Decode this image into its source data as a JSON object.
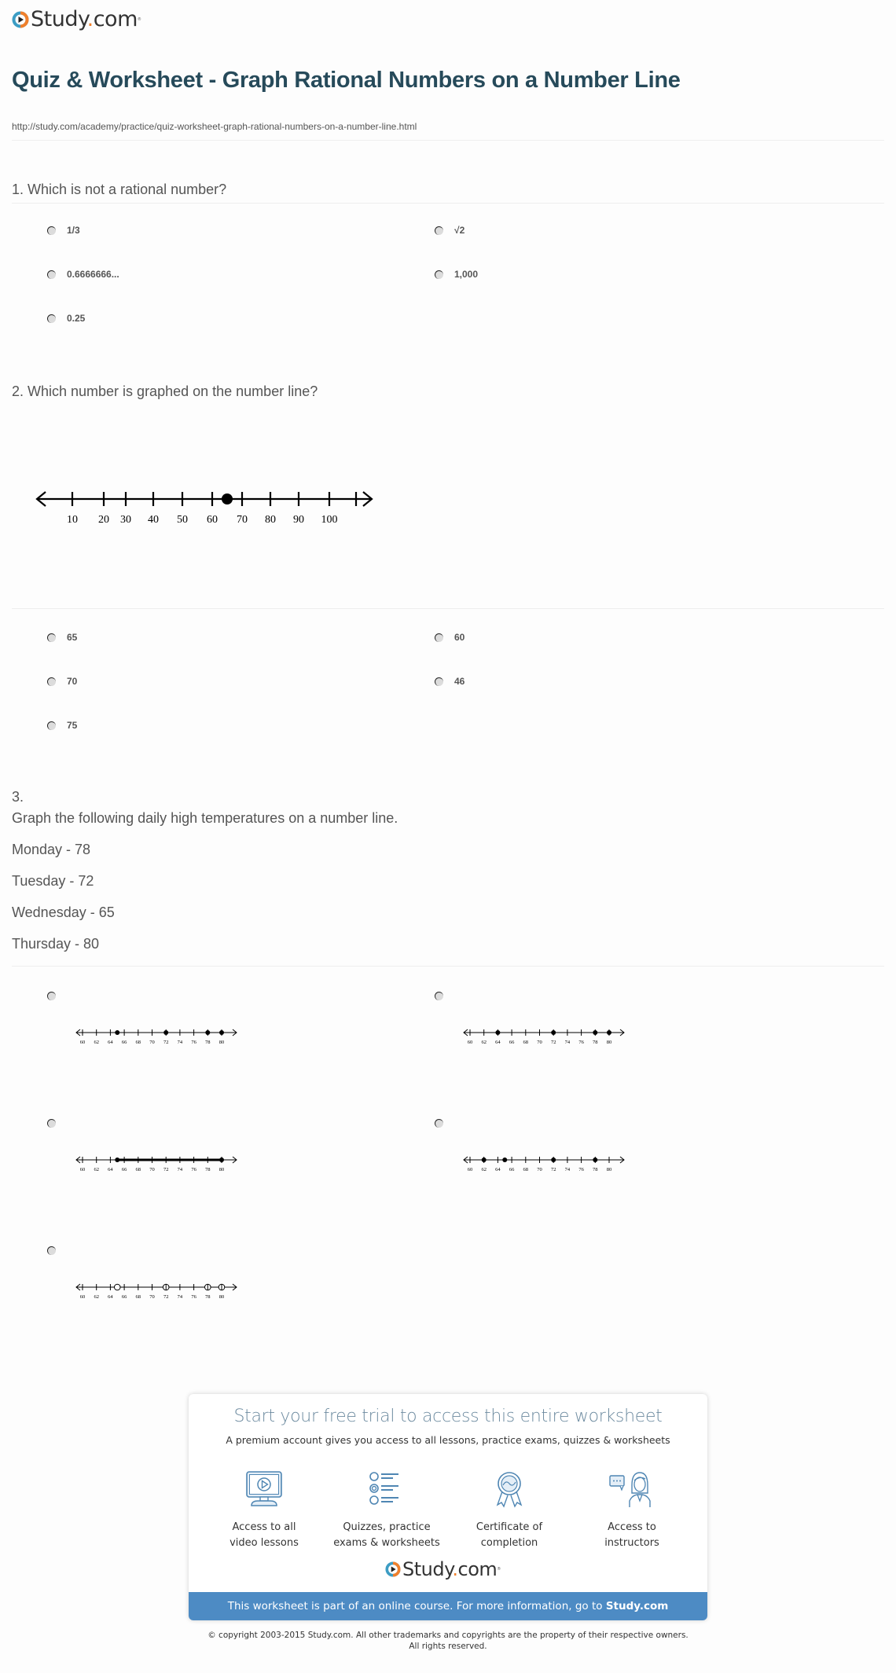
{
  "brand": {
    "name": "Study",
    "dot": ".",
    "tld": "com",
    "reg": "®",
    "colors": {
      "ring_blue": "#3d9dc4",
      "ring_orange": "#f0802c",
      "text": "#333333",
      "title": "#264a5a",
      "accent_blue": "#4d8bc4"
    }
  },
  "header": {
    "title": "Quiz & Worksheet - Graph Rational Numbers on a Number Line",
    "url": "http://study.com/academy/practice/quiz-worksheet-graph-rational-numbers-on-a-number-line.html"
  },
  "questions": [
    {
      "number": "1.",
      "text": "1. Which is not a rational number?",
      "options": [
        "1/3",
        "√2",
        "0.6666666...",
        "1,000",
        "0.25"
      ]
    },
    {
      "number": "2.",
      "text": "2. Which number is graphed on the number line?",
      "figure": {
        "tick_labels": [
          "10",
          "20",
          "30",
          "40",
          "50",
          "60",
          "70",
          "80",
          "90",
          "100"
        ],
        "point_value": 65
      },
      "options": [
        "65",
        "60",
        "70",
        "46",
        "75"
      ]
    },
    {
      "number": "3.",
      "prompt": "Graph the following daily high temperatures on a number line.",
      "lines": [
        "Monday - 78",
        "Tuesday - 72",
        "Wednesday - 65",
        "Thursday - 80"
      ],
      "axis_labels": [
        "60",
        "62",
        "64",
        "66",
        "68",
        "70",
        "72",
        "74",
        "76",
        "78",
        "80"
      ],
      "options": [
        {
          "kind": "points",
          "values": [
            65,
            72,
            78,
            80
          ]
        },
        {
          "kind": "points",
          "values": [
            64,
            72,
            78,
            80
          ]
        },
        {
          "kind": "segment",
          "from": 65,
          "to": 80
        },
        {
          "kind": "points",
          "values": [
            62,
            65,
            72,
            78
          ]
        },
        {
          "kind": "open",
          "values": [
            65,
            72,
            78,
            80
          ]
        }
      ]
    }
  ],
  "promo": {
    "title": "Start your free trial to access this entire worksheet",
    "subtitle": "A premium account gives you access to all lessons, practice exams, quizzes & worksheets",
    "features": [
      {
        "icon": "video-monitor-icon",
        "line1": "Access to all",
        "line2": "video lessons"
      },
      {
        "icon": "quiz-list-icon",
        "line1": "Quizzes, practice",
        "line2": "exams & worksheets"
      },
      {
        "icon": "certificate-ribbon-icon",
        "line1": "Certificate of",
        "line2": "completion"
      },
      {
        "icon": "instructor-chat-icon",
        "line1": "Access to",
        "line2": "instructors"
      }
    ],
    "bar_text": "This worksheet is part of an online course. For more information, go to ",
    "bar_link": "Study.com"
  },
  "footer": {
    "copyright_line1": "© copyright 2003-2015 Study.com. All other trademarks and copyrights are the property of their respective owners.",
    "copyright_line2": "All rights reserved."
  }
}
